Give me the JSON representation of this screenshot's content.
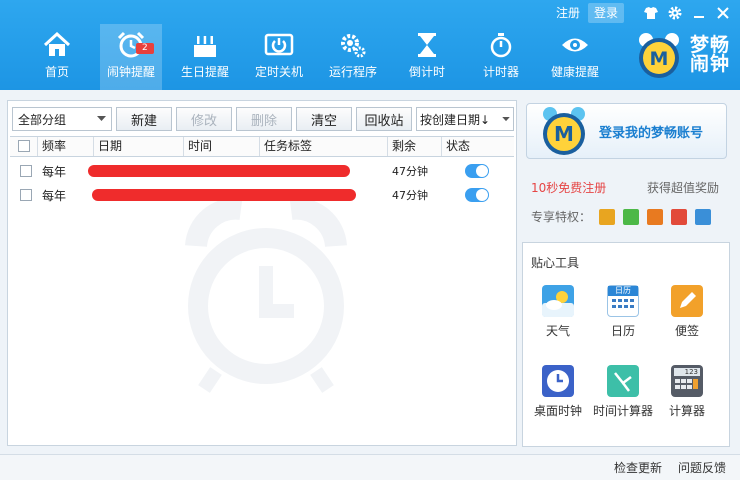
{
  "top": {
    "register": "注册",
    "login": "登录"
  },
  "nav": [
    {
      "label": "首页",
      "icon": "home-icon"
    },
    {
      "label": "闹钟提醒",
      "icon": "alarm-clock-icon",
      "badge": "2"
    },
    {
      "label": "生日提醒",
      "icon": "birthday-cake-icon"
    },
    {
      "label": "定时关机",
      "icon": "power-icon"
    },
    {
      "label": "运行程序",
      "icon": "gears-icon"
    },
    {
      "label": "倒计时",
      "icon": "hourglass-icon"
    },
    {
      "label": "计时器",
      "icon": "stopwatch-icon"
    },
    {
      "label": "健康提醒",
      "icon": "eye-icon"
    }
  ],
  "brand": {
    "line1": "梦畅",
    "line2": "闹钟"
  },
  "toolbar": {
    "group_select": "全部分组",
    "new": "新建",
    "edit": "修改",
    "delete": "删除",
    "clear": "清空",
    "recycle": "回收站",
    "sort_select": "按创建日期↓"
  },
  "table": {
    "columns": [
      "频率",
      "日期",
      "时间",
      "任务标签",
      "剩余",
      "状态"
    ],
    "rows": [
      {
        "freq": "每年",
        "remaining": "47分钟",
        "enabled": true
      },
      {
        "freq": "每年",
        "remaining": "47分钟",
        "enabled": true
      }
    ]
  },
  "side": {
    "login_text": "登录我的梦畅账号",
    "promo_left": "10秒免费注册",
    "promo_right": "获得超值奖励",
    "privilege_label": "专享特权：",
    "tools_title": "贴心工具",
    "tools": [
      {
        "label": "天气",
        "icon": "weather-icon"
      },
      {
        "label": "日历",
        "icon": "calendar-icon",
        "icon_text": "日历"
      },
      {
        "label": "便签",
        "icon": "note-icon"
      },
      {
        "label": "桌面时钟",
        "icon": "desktop-clock-icon"
      },
      {
        "label": "时间计算器",
        "icon": "time-calculator-icon"
      },
      {
        "label": "计算器",
        "icon": "calculator-icon",
        "icon_text": "123"
      }
    ]
  },
  "footer": {
    "check_update": "检查更新",
    "feedback": "问题反馈"
  },
  "colors": {
    "header": "#1d95e4",
    "accent": "#3a9ff0",
    "redacted": "#ef2c2c",
    "promo": "#e64545"
  }
}
